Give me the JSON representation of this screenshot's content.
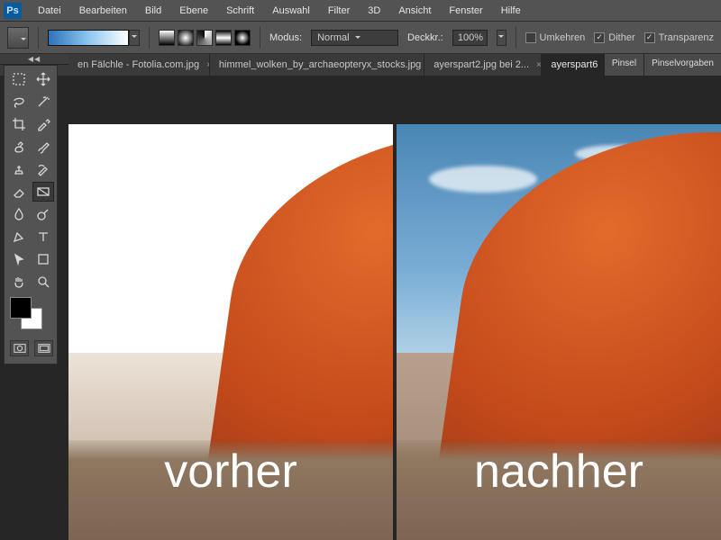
{
  "app_logo": "Ps",
  "menu": [
    "Datei",
    "Bearbeiten",
    "Bild",
    "Ebene",
    "Schrift",
    "Auswahl",
    "Filter",
    "3D",
    "Ansicht",
    "Fenster",
    "Hilfe"
  ],
  "options": {
    "modus_label": "Modus:",
    "modus_value": "Normal",
    "opacity_label": "Deckkr.:",
    "opacity_value": "100%",
    "umkehren": "Umkehren",
    "dither": "Dither",
    "transparenz": "Transparenz"
  },
  "tabs": [
    {
      "label": "en Fälchle - Fotolia.com.jpg",
      "active": false
    },
    {
      "label": "himmel_wolken_by_archaeopteryx_stocks.jpg",
      "active": false
    },
    {
      "label": "ayerspart2.jpg bei 2...",
      "active": false
    },
    {
      "label": "ayerspart6",
      "active": true
    }
  ],
  "panel_tabs": [
    "Pinsel",
    "Pinselvorgaben"
  ],
  "captions": {
    "left": "vorher",
    "right": "nachher"
  },
  "dock_toggle": "◀◀"
}
